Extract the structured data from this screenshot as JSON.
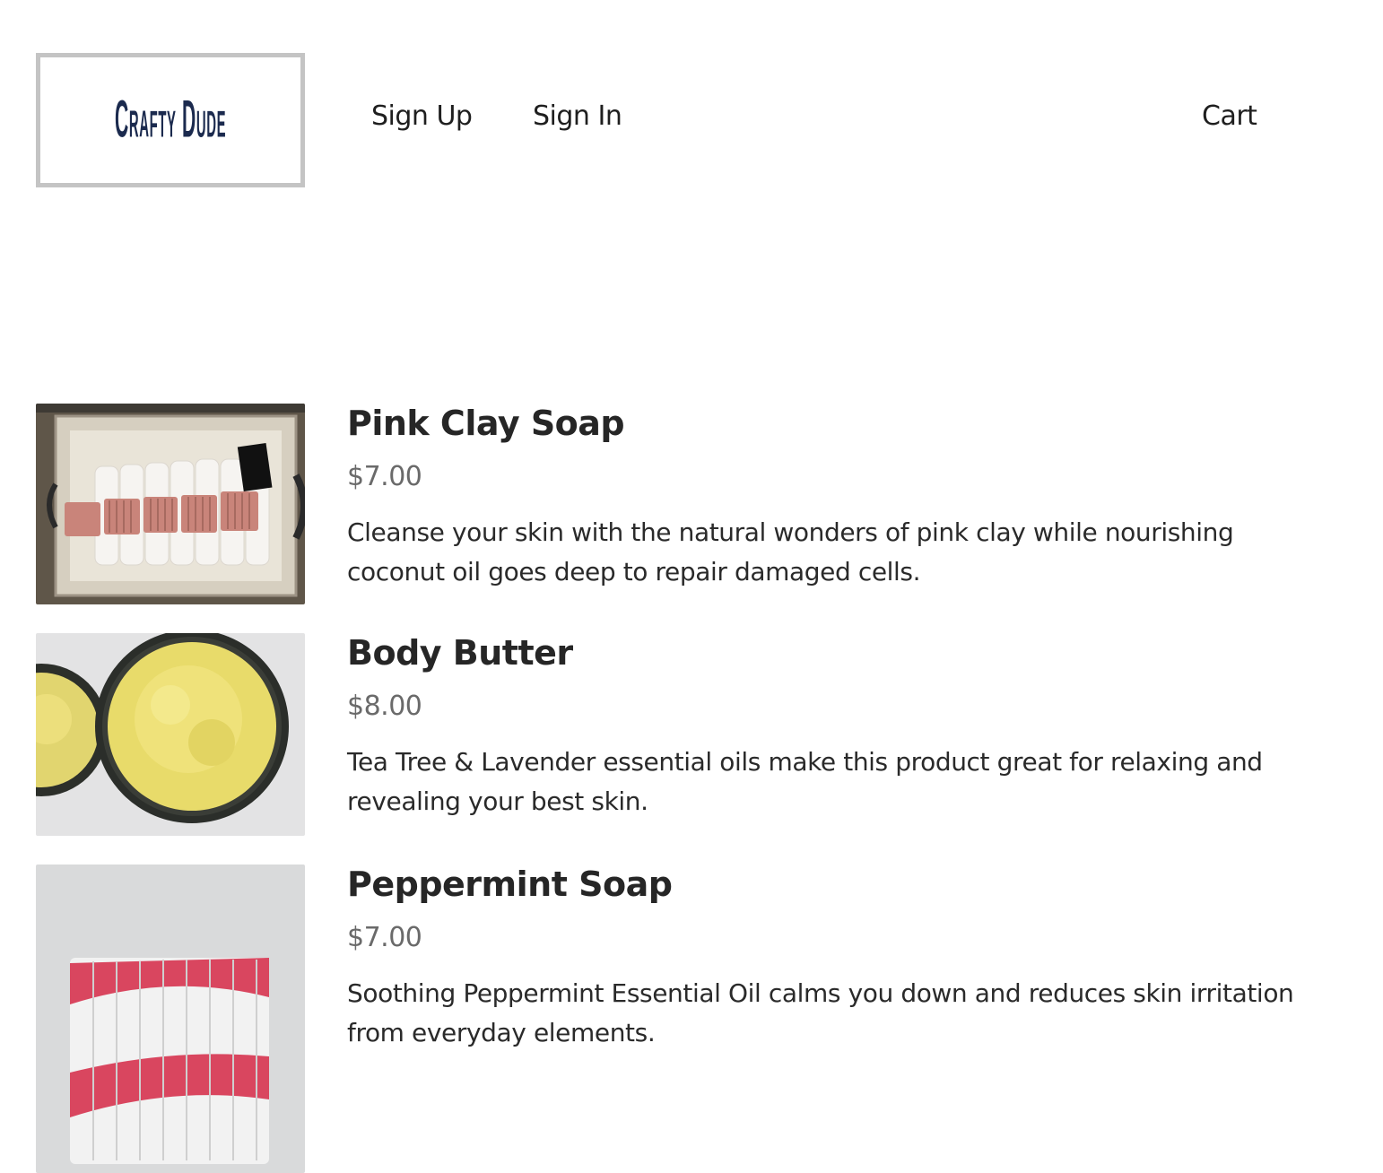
{
  "header": {
    "logo_text": "Crafty Dude",
    "nav": {
      "sign_up": "Sign Up",
      "sign_in": "Sign In",
      "cart": "Cart"
    }
  },
  "products": [
    {
      "title": "Pink Clay Soap",
      "price": "$7.00",
      "description": "Cleanse your skin with the natural wonders of pink clay while nourishing coconut oil goes deep to repair damaged cells.",
      "image": "pink-clay-soap-photo"
    },
    {
      "title": "Body Butter",
      "price": "$8.00",
      "description": "Tea Tree & Lavender essential oils make this product great for relaxing and revealing your best skin.",
      "image": "body-butter-photo"
    },
    {
      "title": "Peppermint Soap",
      "price": "$7.00",
      "description": "Soothing Peppermint Essential Oil calms you down and reduces skin irritation from everyday elements.",
      "image": "peppermint-soap-photo"
    }
  ],
  "colors": {
    "logo_text": "#1b2a4e",
    "logo_border": "#c4c4c4",
    "price_text": "#6a6a6a"
  }
}
